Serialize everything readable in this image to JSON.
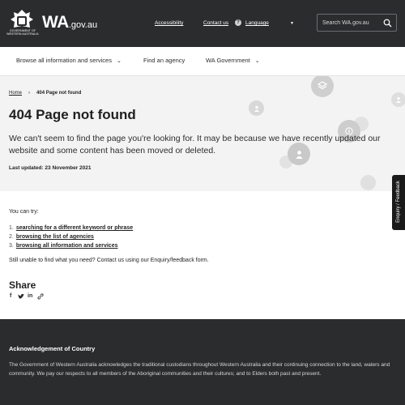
{
  "header": {
    "crest_text": "GOVERNMENT OF WESTERN AUSTRALIA",
    "logo_main": "WA",
    "logo_domain": ".gov.au",
    "accessibility": "Accessibility",
    "contact": "Contact us",
    "language": "Language",
    "language_icon": "globe-icon",
    "search_placeholder": "Search WA.gov.au",
    "colors": {
      "background": "#2b2c2e",
      "text": "#ffffff"
    }
  },
  "nav": {
    "items": [
      {
        "label": "Browse all information and services",
        "has_dropdown": true
      },
      {
        "label": "Find an agency",
        "has_dropdown": false
      },
      {
        "label": "WA Government",
        "has_dropdown": true
      }
    ]
  },
  "hero": {
    "breadcrumb": {
      "home": "Home",
      "separator": "›",
      "current": "404 Page not found"
    },
    "title": "404 Page not found",
    "lead": "We can't seem to find the page you're looking for. It may be because we have recently updated our website and some content has been moved or deleted.",
    "updated": "Last updated: 23 November 2021",
    "background": "#f3f3f3"
  },
  "feedback_tab": "Enquiry / Feedback",
  "main": {
    "try_intro": "You can try:",
    "suggestions": [
      {
        "num": "1.",
        "label": "searching for a different keyword or phrase"
      },
      {
        "num": "2.",
        "label": "browsing the list of agencies"
      },
      {
        "num": "3.",
        "label": "browsing all information and services"
      }
    ],
    "still_unable": "Still unable to find what you need? Contact us using our Enquiry/feedback form.",
    "share_title": "Share",
    "share_icons": [
      "facebook-icon",
      "twitter-icon",
      "linkedin-icon",
      "link-icon"
    ]
  },
  "footer": {
    "ack_title": "Acknowledgement of Country",
    "ack_text": "The Government of Western Australia acknowledges the traditional custodians throughout Western Australia and their continuing connection to the land, waters and community. We pay our respects to all members of the Aboriginal communities and their cultures; and to Elders both past and present."
  }
}
